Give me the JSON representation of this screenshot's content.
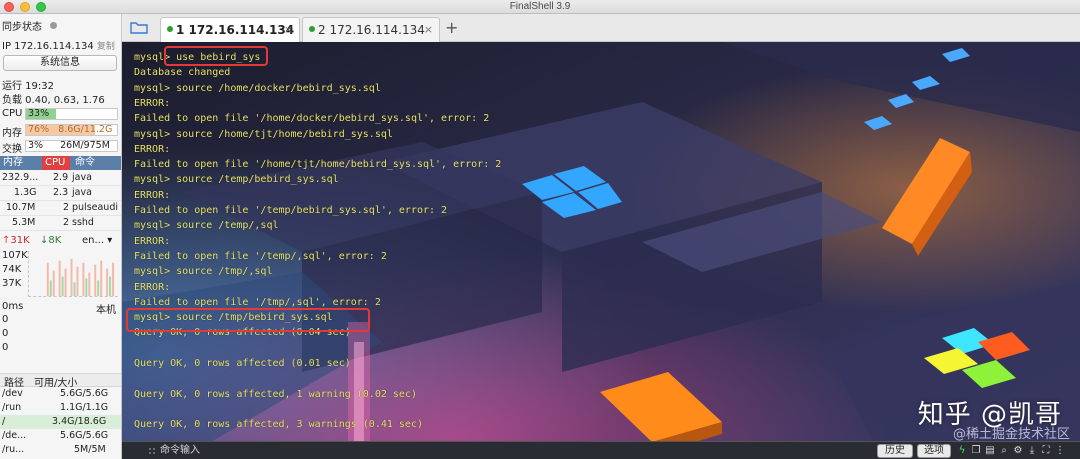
{
  "window": {
    "title": "FinalShell 3.9"
  },
  "sidebar": {
    "sync_status": "同步状态",
    "ip_label": "IP 172.16.114.134",
    "copy_label": "复制",
    "sysinfo_button": "系统信息",
    "uptime": "运行 19:32",
    "load": "负载 0.40, 0.63, 1.76",
    "cpu": {
      "label": "CPU",
      "value": "33%",
      "percent": 33
    },
    "mem": {
      "label": "内存",
      "percent_text": "76%",
      "detail": "8.6G/11.2G",
      "percent": 76
    },
    "swap": {
      "label": "交换",
      "percent_text": "3%",
      "detail": "26M/975M",
      "percent": 3
    },
    "process_table": {
      "headers": [
        "内存",
        "CPU",
        "命令"
      ],
      "rows": [
        {
          "mem": "232.9...",
          "cpu": "2.9",
          "cmd": "java"
        },
        {
          "mem": "1.3G",
          "cpu": "2.3",
          "cmd": "java"
        },
        {
          "mem": "10.7M",
          "cpu": "2",
          "cmd": "pulseaudi"
        },
        {
          "mem": "5.3M",
          "cpu": "2",
          "cmd": "sshd"
        }
      ]
    },
    "network": {
      "up": "31K",
      "down": "8K",
      "iface": "en...",
      "scale": [
        "107K",
        "74K",
        "37K"
      ]
    },
    "latency": {
      "label": "0ms",
      "host": "本机",
      "values": [
        "0",
        "0",
        "0"
      ]
    },
    "disk_table": {
      "headers": [
        "路径",
        "可用/大小"
      ],
      "rows": [
        {
          "path": "/dev",
          "size": "5.6G/5.6G",
          "highlight": false
        },
        {
          "path": "/run",
          "size": "1.1G/1.1G",
          "highlight": false
        },
        {
          "path": "/",
          "size": "3.4G/18.6G",
          "highlight": true
        },
        {
          "path": "/de...",
          "size": "5.6G/5.6G",
          "highlight": false
        },
        {
          "path": "/ru...",
          "size": "5M/5M",
          "highlight": false
        }
      ]
    }
  },
  "tabs": [
    {
      "label": "1 172.16.114.134",
      "active": true,
      "close": "×"
    },
    {
      "label": "2 172.16.114.134",
      "active": false,
      "close": "×"
    }
  ],
  "tab_add": "+",
  "terminal": {
    "lines": [
      "mysql> use bebird_sys",
      "Database changed",
      "mysql> source /home/docker/bebird_sys.sql",
      "ERROR:",
      "Failed to open file '/home/docker/bebird_sys.sql', error: 2",
      "mysql> source /home/tjt/home/bebird_sys.sql",
      "ERROR:",
      "Failed to open file '/home/tjt/home/bebird_sys.sql', error: 2",
      "mysql> source /temp/bebird_sys.sql",
      "ERROR:",
      "Failed to open file '/temp/bebird_sys.sql', error: 2",
      "mysql> source /temp/,sql",
      "ERROR:",
      "Failed to open file '/temp/,sql', error: 2",
      "mysql> source /tmp/,sql",
      "ERROR:",
      "Failed to open file '/tmp/,sql', error: 2",
      "mysql> source /tmp/bebird_sys.sql",
      "Query OK, 0 rows affected (0.04 sec)",
      "",
      "Query OK, 0 rows affected (0.01 sec)",
      "",
      "Query OK, 0 rows affected, 1 warning (0.02 sec)",
      "",
      "Query OK, 0 rows affected, 3 warnings (0.41 sec)"
    ],
    "watermark_main": "知乎 @凯哥",
    "watermark_sub": "@稀土掘金技术社区"
  },
  "command_bar": {
    "label": "命令输入",
    "history_button": "历史",
    "options_button": "选项"
  },
  "colors": {
    "terminal_text": "#e8e36a",
    "highlight": "#e53935",
    "cpu_fill": "#8fd18f",
    "mem_fill": "#f6c9a4",
    "header_blue": "#5b7fa8"
  }
}
